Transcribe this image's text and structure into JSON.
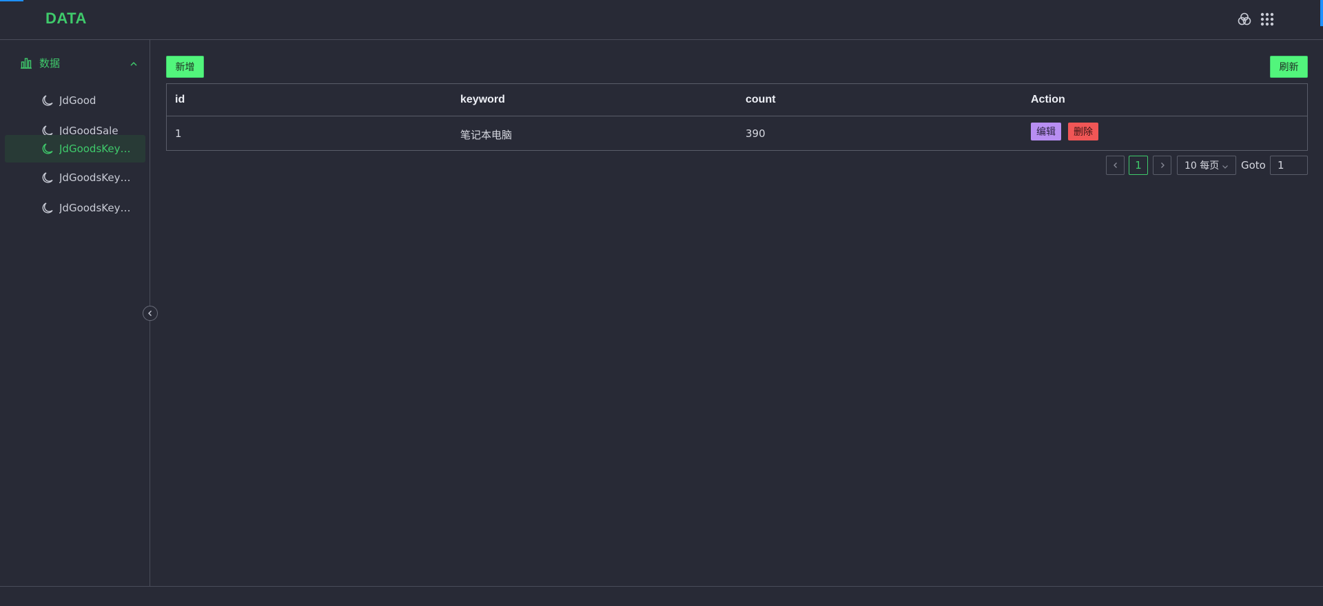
{
  "header": {
    "logo": "DATA",
    "icons": [
      "theme-icon",
      "apps-grid-icon"
    ]
  },
  "sidebar": {
    "group": {
      "label": "数据",
      "icon": "bar-chart-icon",
      "expanded": true
    },
    "items": [
      {
        "label": "JdGood",
        "icon": "moon-icon",
        "active": false
      },
      {
        "label": "JdGoodSale",
        "icon": "moon-icon",
        "active": false
      },
      {
        "label": "JdGoodsKeyw...",
        "icon": "moon-icon",
        "active": true
      },
      {
        "label": "JdGoodsKeyw...",
        "icon": "moon-icon",
        "active": false
      },
      {
        "label": "JdGoodsKeyw...",
        "icon": "moon-icon",
        "active": false
      }
    ]
  },
  "toolbar": {
    "add_label": "新增",
    "refresh_label": "刷新"
  },
  "table": {
    "columns": [
      "id",
      "keyword",
      "count",
      "Action"
    ],
    "rows": [
      {
        "id": "1",
        "keyword": "笔记本电脑",
        "count": "390"
      }
    ],
    "edit_label": "编辑",
    "delete_label": "删除"
  },
  "pagination": {
    "current_page": "1",
    "page_size": "10 每页",
    "goto_label": "Goto",
    "goto_value": "1"
  },
  "colors": {
    "accent": "#3fca6b",
    "button_green": "#52f57c",
    "edit": "#b88ef2",
    "delete": "#f05656",
    "background": "#282a36"
  }
}
